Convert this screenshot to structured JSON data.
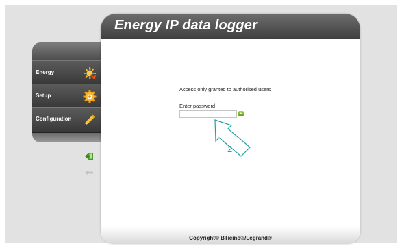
{
  "header": {
    "title": "Energy IP data logger"
  },
  "sidebar": {
    "items": [
      {
        "label": "Energy",
        "icon": "energy-icon"
      },
      {
        "label": "Setup",
        "icon": "gear-icon"
      },
      {
        "label": "Configuration",
        "icon": "pencil-icon"
      }
    ],
    "actions": [
      {
        "icon": "logout-icon"
      },
      {
        "icon": "back-arrow-icon"
      }
    ]
  },
  "login": {
    "message": "Access only granted to authorised users",
    "password_label": "Enter password",
    "password_value": "",
    "go_icon": "go-arrow-icon"
  },
  "callout": {
    "number": "2"
  },
  "footer": {
    "copyright": "Copyright© BTicino®/Legrand®"
  },
  "colors": {
    "header": "#4f4f4f",
    "sidebar": "#464646",
    "go_button": "#7ab82a",
    "callout": "#1ea0aa",
    "logout_icon": "#4a9a2a"
  }
}
